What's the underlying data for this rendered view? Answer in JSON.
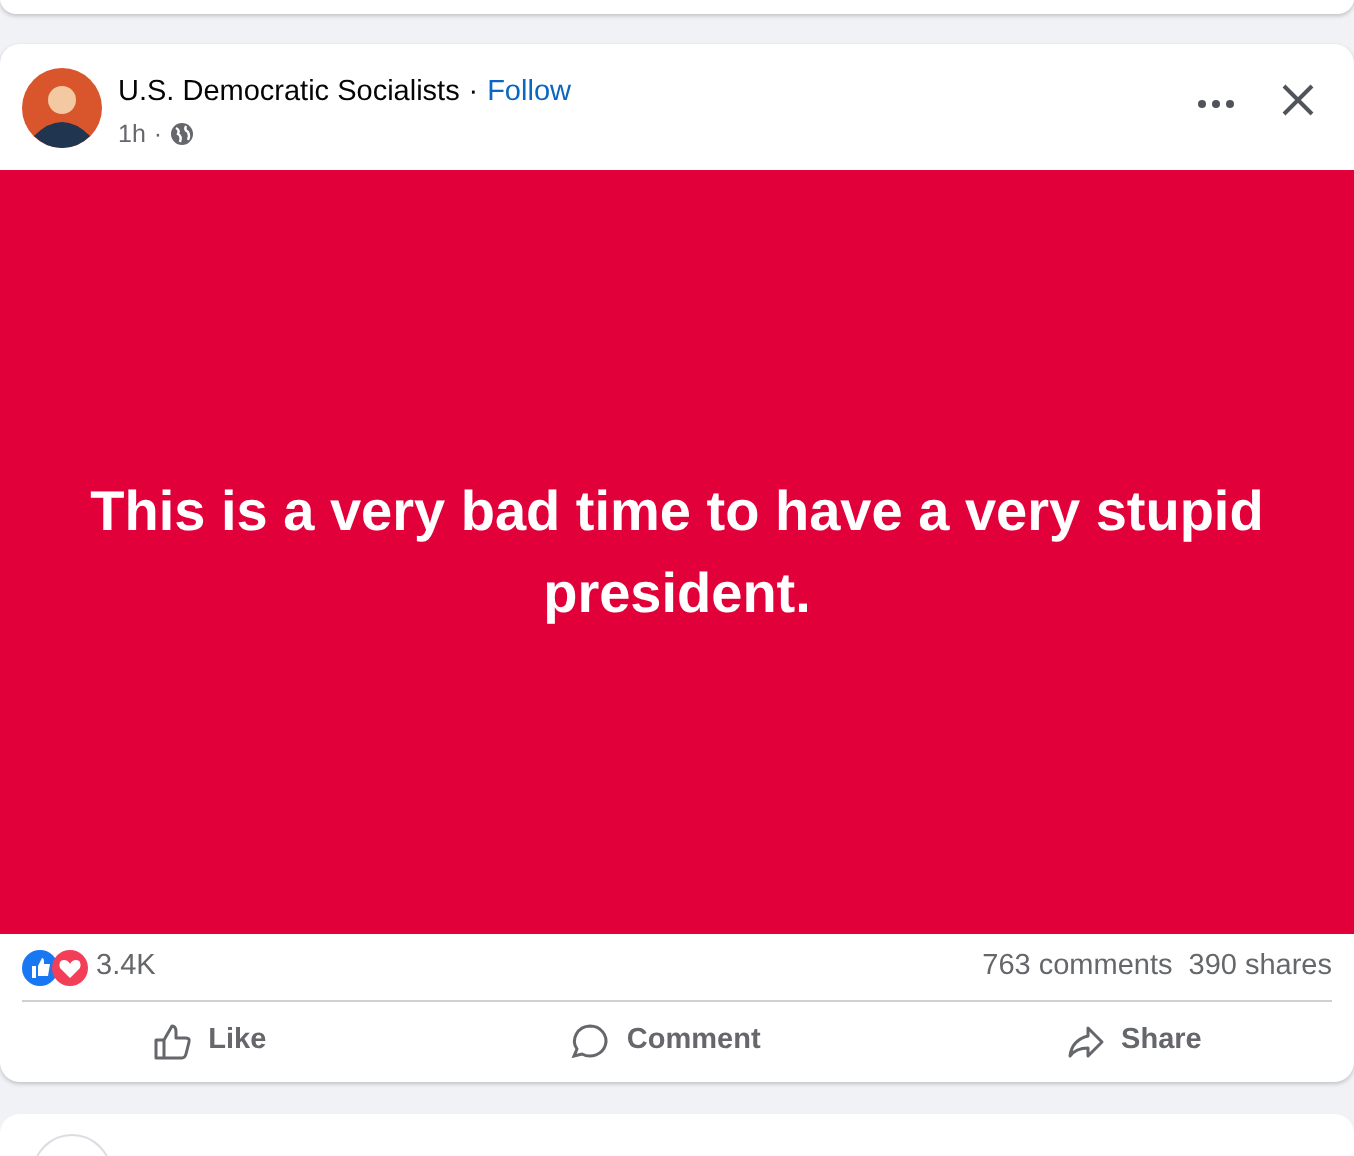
{
  "post": {
    "author": "U.S. Democratic Socialists",
    "separator": "·",
    "follow": "Follow",
    "time": "1h",
    "time_separator": "·",
    "image_text": "This is a very bad time to have a very stupid president.",
    "reaction_count": "3.4K",
    "comments": "763 comments",
    "shares": "390 shares",
    "actions": [
      {
        "kind": "like",
        "label": "Like"
      },
      {
        "kind": "comment",
        "label": "Comment"
      },
      {
        "kind": "share",
        "label": "Share"
      }
    ]
  }
}
